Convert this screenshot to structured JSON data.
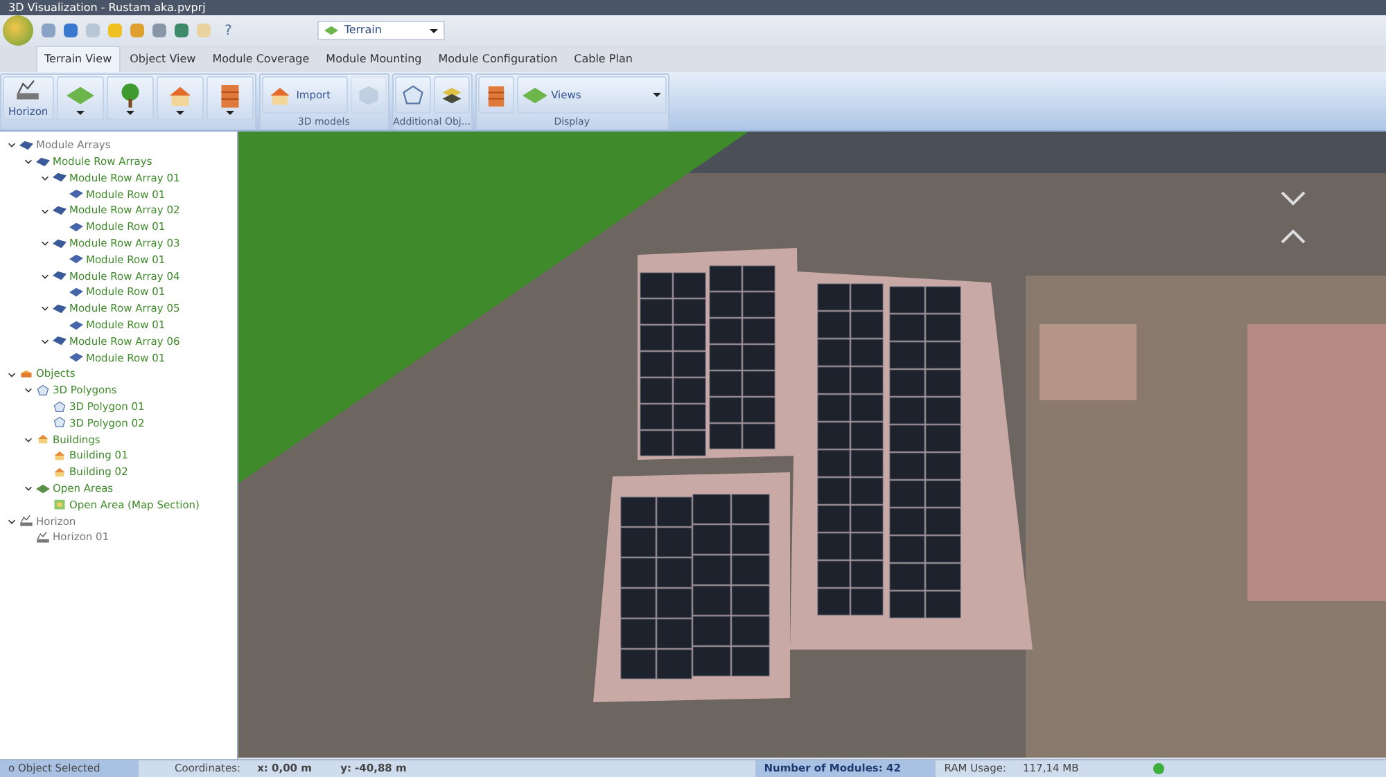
{
  "window": {
    "title": "3D Visualization - Rustam aka.pvprj"
  },
  "quick_toolbar": {
    "help": "?",
    "terrain_select": "Terrain"
  },
  "tabs": [
    {
      "label": "Terrain View",
      "selected": true
    },
    {
      "label": "Object View",
      "selected": false
    },
    {
      "label": "Module Coverage",
      "selected": false
    },
    {
      "label": "Module Mounting",
      "selected": false
    },
    {
      "label": "Module Configuration",
      "selected": false
    },
    {
      "label": "Cable Plan",
      "selected": false
    }
  ],
  "ribbon": [
    {
      "items": [
        {
          "kind": "large",
          "label": "Horizon",
          "disabled": false
        },
        {
          "kind": "dropdown",
          "disabled": false
        },
        {
          "kind": "dropdown",
          "disabled": false
        },
        {
          "kind": "dropdown",
          "disabled": false
        },
        {
          "kind": "dropdown",
          "disabled": false
        }
      ]
    },
    {
      "label": "3D models",
      "items": [
        {
          "kind": "wide",
          "label": "Import",
          "disabled": false
        },
        {
          "kind": "icon",
          "disabled": true
        }
      ]
    },
    {
      "label": "Additional Obj...",
      "items": [
        {
          "kind": "icon",
          "disabled": false
        },
        {
          "kind": "icon",
          "disabled": false
        }
      ]
    },
    {
      "label": "Display",
      "items": [
        {
          "kind": "icon",
          "disabled": false
        },
        {
          "kind": "menu",
          "label": "Views",
          "disabled": false
        }
      ]
    }
  ],
  "tree": [
    {
      "label": "Module Arrays",
      "kind": "array",
      "muted": true,
      "expanded": true,
      "children": [
        {
          "label": "Module Row Arrays",
          "kind": "array",
          "muted": false,
          "expanded": true,
          "children": [
            {
              "label": "Module Row Array 01",
              "kind": "array",
              "muted": false,
              "expanded": true,
              "children": [
                {
                  "label": "Module Row 01",
                  "kind": "row",
                  "muted": false
                }
              ]
            },
            {
              "label": "Module Row Array 02",
              "kind": "array",
              "muted": false,
              "expanded": true,
              "children": [
                {
                  "label": "Module Row 01",
                  "kind": "row",
                  "muted": false
                }
              ]
            },
            {
              "label": "Module Row Array 03",
              "kind": "array",
              "muted": false,
              "expanded": true,
              "children": [
                {
                  "label": "Module Row 01",
                  "kind": "row",
                  "muted": false
                }
              ]
            },
            {
              "label": "Module Row Array 04",
              "kind": "array",
              "muted": false,
              "expanded": true,
              "children": [
                {
                  "label": "Module Row 01",
                  "kind": "row",
                  "muted": false
                }
              ]
            },
            {
              "label": "Module Row Array 05",
              "kind": "array",
              "muted": false,
              "expanded": true,
              "children": [
                {
                  "label": "Module Row 01",
                  "kind": "row",
                  "muted": false
                }
              ]
            },
            {
              "label": "Module Row Array 06",
              "kind": "array",
              "muted": false,
              "expanded": true,
              "children": [
                {
                  "label": "Module Row 01",
                  "kind": "row",
                  "muted": false
                }
              ]
            }
          ]
        }
      ]
    },
    {
      "label": "Objects",
      "kind": "objects",
      "muted": false,
      "expanded": true,
      "children": [
        {
          "label": "3D Polygons",
          "kind": "polygon",
          "muted": false,
          "expanded": true,
          "children": [
            {
              "label": "3D Polygon 01",
              "kind": "polygon",
              "muted": false
            },
            {
              "label": "3D Polygon 02",
              "kind": "polygon",
              "muted": false
            }
          ]
        },
        {
          "label": "Buildings",
          "kind": "building",
          "muted": false,
          "expanded": true,
          "children": [
            {
              "label": "Building 01",
              "kind": "building",
              "muted": false
            },
            {
              "label": "Building 02",
              "kind": "building",
              "muted": false
            }
          ]
        },
        {
          "label": "Open Areas",
          "kind": "area",
          "muted": false,
          "expanded": true,
          "children": [
            {
              "label": "Open Area (Map Section)",
              "kind": "map",
              "muted": false
            }
          ]
        }
      ]
    },
    {
      "label": "Horizon",
      "kind": "horizon",
      "muted": true,
      "expanded": true,
      "children": [
        {
          "label": "Horizon 01",
          "kind": "horizon",
          "muted": true
        }
      ]
    }
  ],
  "status_bar": {
    "selection": "o Object Selected",
    "coordinates_label": "Coordinates:",
    "x": "x: 0,00 m",
    "y": "y: -40,88 m",
    "modules": "Number of Modules: 42",
    "ram_label": "RAM Usage:",
    "ram": "117,14 MB"
  }
}
